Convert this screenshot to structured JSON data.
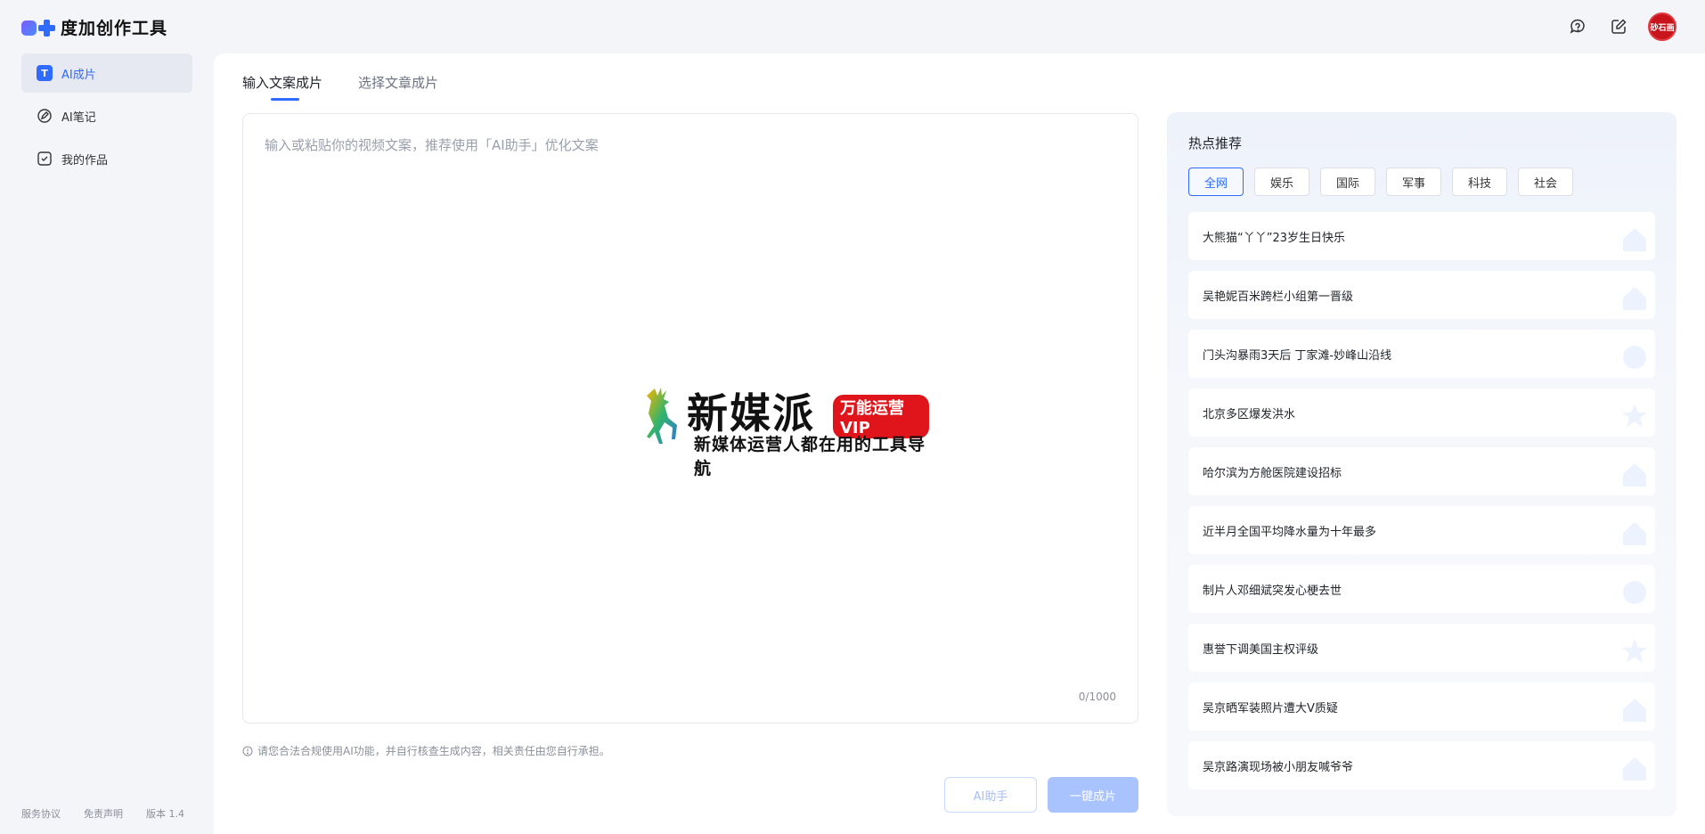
{
  "app": {
    "title": "度加创作工具"
  },
  "header": {
    "avatar_text": "砂石画",
    "icons": [
      "feedback-icon",
      "edit-icon"
    ]
  },
  "sidebar": {
    "items": [
      {
        "label": "AI成片",
        "icon": "t-icon",
        "active": true
      },
      {
        "label": "AI笔记",
        "icon": "pen-icon",
        "active": false
      },
      {
        "label": "我的作品",
        "icon": "check-box-icon",
        "active": false
      }
    ],
    "footer": {
      "terms": "服务协议",
      "disclaimer": "免责声明",
      "version": "版本 1.4"
    }
  },
  "main": {
    "tabs": [
      {
        "label": "输入文案成片",
        "active": true
      },
      {
        "label": "选择文章成片",
        "active": false
      }
    ],
    "editor": {
      "placeholder": "输入或粘贴你的视频文案，推荐使用「AI助手」优化文案",
      "value": "",
      "counter": "0/1000"
    },
    "notice": "请您合法合规使用AI功能，并自行核查生成内容，相关责任由您自行承担。",
    "buttons": {
      "assistant": "AI助手",
      "generate": "一键成片"
    }
  },
  "watermark": {
    "title": "新媒派",
    "badge": "万能运营VIP",
    "subtitle": "新媒体运营人都在用的工具导航"
  },
  "hot": {
    "title": "热点推荐",
    "categories": [
      {
        "label": "全网",
        "active": true
      },
      {
        "label": "娱乐",
        "active": false
      },
      {
        "label": "国际",
        "active": false
      },
      {
        "label": "军事",
        "active": false
      },
      {
        "label": "科技",
        "active": false
      },
      {
        "label": "社会",
        "active": false
      }
    ],
    "items": [
      "大熊猫“丫丫”23岁生日快乐",
      "吴艳妮百米跨栏小组第一晋级",
      "门头沟暴雨3天后 丁家滩-妙峰山沿线",
      "北京多区爆发洪水",
      "哈尔滨为方舱医院建设招标",
      "近半月全国平均降水量为十年最多",
      "制片人邓细斌突发心梗去世",
      "惠誉下调美国主权评级",
      "吴京晒军装照片遭大V质疑",
      "吴京路演现场被小朋友喊爷爷"
    ]
  },
  "colors": {
    "accent": "#2f6bff",
    "button_disabled": "#a9c3ff",
    "background": "#f4f5f9"
  }
}
